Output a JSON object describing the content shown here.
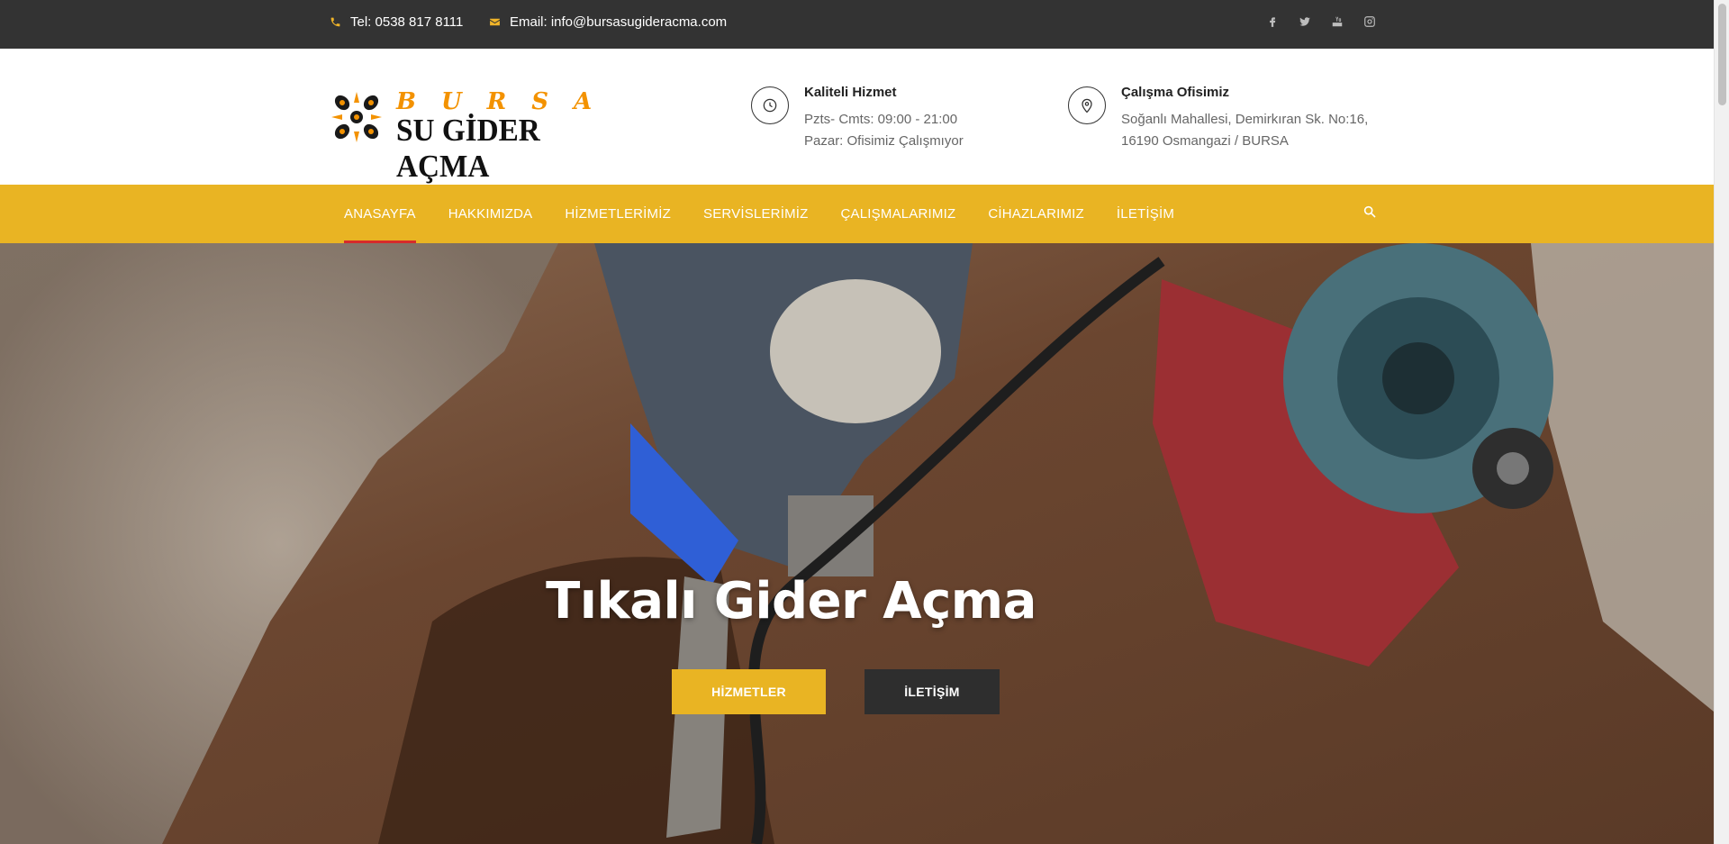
{
  "topbar": {
    "phone": "Tel: 0538 817 8111",
    "email": "Email: info@bursasugideracma.com",
    "socials": [
      "facebook-icon",
      "twitter-icon",
      "youtube-icon",
      "instagram-icon"
    ]
  },
  "header": {
    "logo": {
      "line1": "BURSA",
      "line2": "SU GİDER AÇMA"
    },
    "service": {
      "title": "Kaliteli Hizmet",
      "line1": "Pzts- Cmts: 09:00 - 21:00",
      "line2": "Pazar: Ofisimiz Çalışmıyor"
    },
    "office": {
      "title": "Çalışma Ofisimiz",
      "line1": "Soğanlı Mahallesi, Demirkıran Sk. No:16,",
      "line2": "16190 Osmangazi / BURSA"
    }
  },
  "nav": {
    "items": [
      "ANASAYFA",
      "HAKKIMIZDA",
      "HİZMETLERİMİZ",
      "SERVİSLERİMİZ",
      "ÇALIŞMALARIMIZ",
      "CİHAZLARIMIZ",
      "İLETİŞİM"
    ],
    "active": "ANASAYFA"
  },
  "hero": {
    "title": "Tıkalı Gider Açma",
    "primary_button": "HİZMETLER",
    "secondary_button": "İLETİŞİM"
  },
  "colors": {
    "accent": "#e9b423",
    "topbar": "#333333",
    "active_underline": "#d62b2b",
    "dark_button": "#2e2e2e"
  }
}
